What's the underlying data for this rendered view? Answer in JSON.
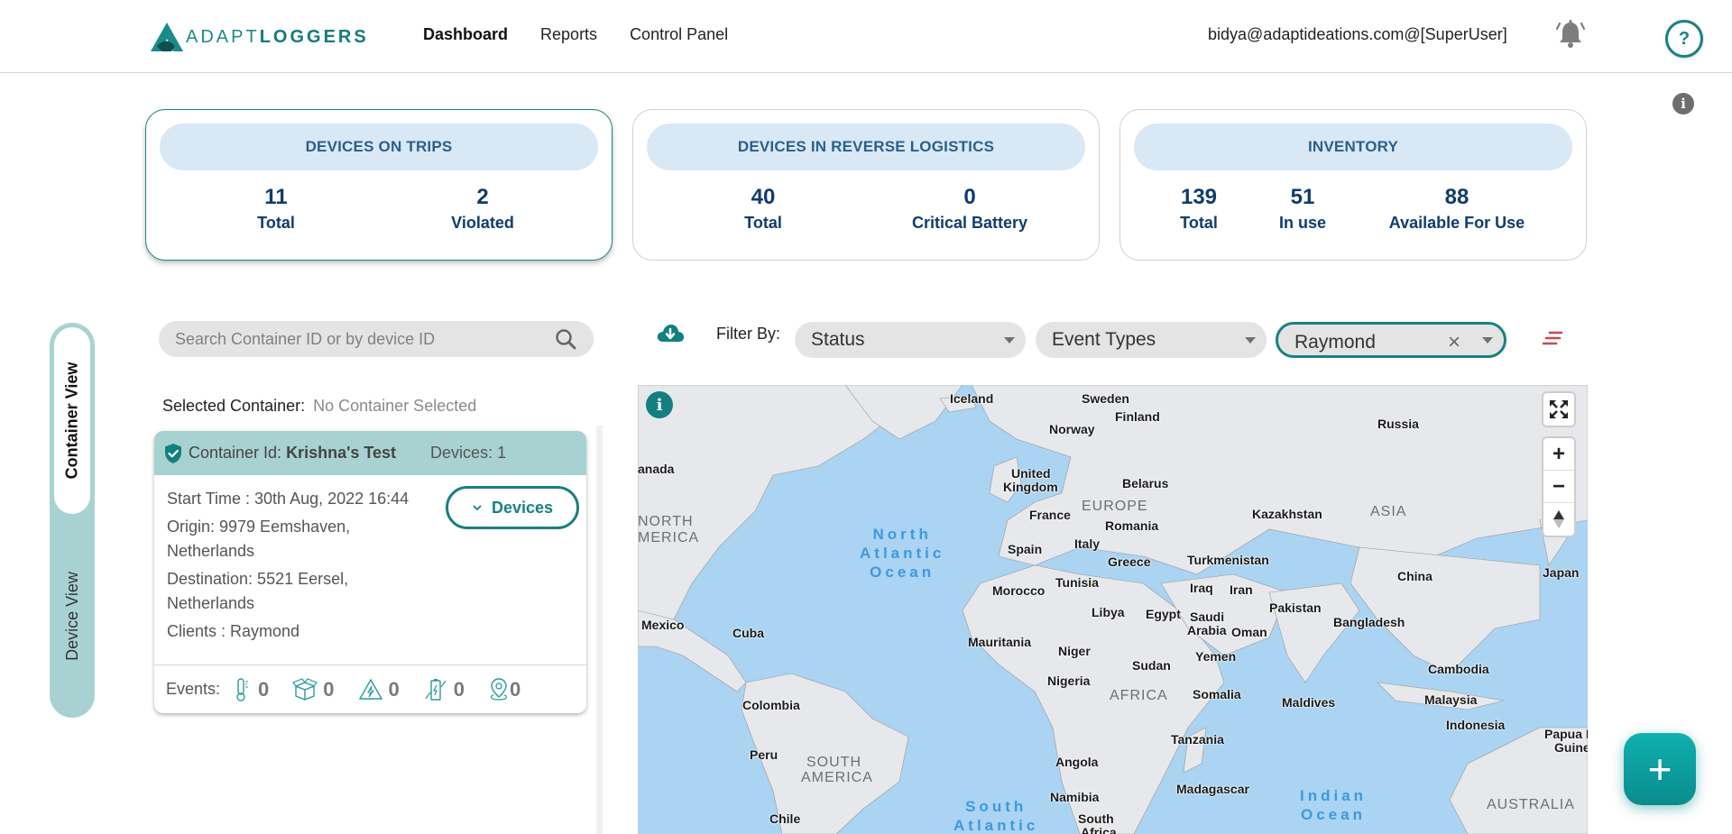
{
  "header": {
    "logo": {
      "part1": "ADAPT",
      "part2": "LOGGERS"
    },
    "nav": [
      {
        "label": "Dashboard",
        "active": true
      },
      {
        "label": "Reports",
        "active": false
      },
      {
        "label": "Control Panel",
        "active": false
      }
    ],
    "user": "bidya@adaptideations.com@[SuperUser]",
    "help_label": "?",
    "info_label": "i"
  },
  "stats": [
    {
      "title": "DEVICES ON TRIPS",
      "active": true,
      "items": [
        {
          "value": "11",
          "label": "Total"
        },
        {
          "value": "2",
          "label": "Violated"
        }
      ]
    },
    {
      "title": "DEVICES IN REVERSE LOGISTICS",
      "active": false,
      "items": [
        {
          "value": "40",
          "label": "Total"
        },
        {
          "value": "0",
          "label": "Critical Battery"
        }
      ]
    },
    {
      "title": "INVENTORY",
      "active": false,
      "items": [
        {
          "value": "139",
          "label": "Total"
        },
        {
          "value": "51",
          "label": "In use"
        },
        {
          "value": "88",
          "label": "Available For Use"
        }
      ]
    }
  ],
  "view_toggle": {
    "active": "Container View",
    "inactive": "Device View"
  },
  "search": {
    "placeholder": "Search Container ID or by device ID",
    "value": ""
  },
  "selected_container": {
    "label": "Selected Container:",
    "value": "No Container Selected"
  },
  "container_card": {
    "id_label": "Container Id:",
    "id_value": "Krishna's Test",
    "devices_count": "Devices: 1",
    "start_time": "Start Time : 30th Aug, 2022 16:44",
    "origin": "Origin: 9979 Eemshaven, Netherlands",
    "destination": "Destination: 5521 Eersel, Netherlands",
    "clients": "Clients : Raymond",
    "devices_button": "Devices",
    "events_label": "Events:",
    "events": [
      {
        "icon": "thermometer-icon",
        "count": "0"
      },
      {
        "icon": "open-box-icon",
        "count": "0"
      },
      {
        "icon": "shock-warning-icon",
        "count": "0"
      },
      {
        "icon": "battery-icon",
        "count": "0"
      },
      {
        "icon": "location-pin-icon",
        "count": "0"
      }
    ]
  },
  "filters": {
    "label": "Filter By:",
    "status": {
      "value": "Status"
    },
    "event_types": {
      "value": "Event Types"
    },
    "client": {
      "value": "Raymond"
    }
  },
  "map": {
    "info_label": "i",
    "zoom_in": "+",
    "zoom_out": "−",
    "countries": [
      "Iceland",
      "Sweden",
      "Finland",
      "Norway",
      "Russia",
      "anada",
      "United",
      "Kingdom",
      "Belarus",
      "EUROPE",
      "France",
      "Romania",
      "Kazakhstan",
      "ASIA",
      "Spain",
      "Italy",
      "Greece",
      "Turkmenistan",
      "China",
      "Japan",
      "Tunisia",
      "Morocco",
      "Iraq",
      "Iran",
      "Pakistan",
      "Libya",
      "Egypt",
      "Saudi",
      "Arabia",
      "Oman",
      "Bangladesh",
      "Mexico",
      "Cuba",
      "Mauritania",
      "Niger",
      "Yemen",
      "Nigeria",
      "Sudan",
      "AFRICA",
      "Somalia",
      "Maldives",
      "Cambodia",
      "Malaysia",
      "Colombia",
      "Indonesia",
      "Tanzania",
      "Papua N",
      "Guine",
      "Peru",
      "Angola",
      "SOUTH",
      "AMERICA",
      "Madagascar",
      "Namibia",
      "AUSTRALIA",
      "Chile",
      "South",
      "Africa"
    ],
    "oceans": {
      "north_atlantic": "North\nAtlantic\nOcean",
      "south_atlantic": "South\nAtlantic",
      "indian": "Indian\nOcean"
    },
    "north_america": "NORTH\nMERICA"
  },
  "fab_label": "+"
}
